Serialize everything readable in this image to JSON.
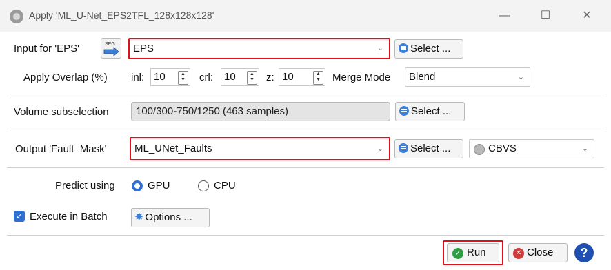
{
  "window": {
    "title": "Apply 'ML_U-Net_EPS2TFL_128x128x128'",
    "minimize": "—",
    "maximize": "☐",
    "close": "✕"
  },
  "input": {
    "label": "Input for 'EPS'",
    "value": "EPS",
    "select_label": "Select ..."
  },
  "overlap": {
    "label": "Apply Overlap (%)",
    "inl_label": "inl:",
    "inl_value": "10",
    "crl_label": "crl:",
    "crl_value": "10",
    "z_label": "z:",
    "z_value": "10",
    "merge_label": "Merge Mode",
    "merge_value": "Blend"
  },
  "volume": {
    "label": "Volume subselection",
    "value": "100/300-750/1250 (463 samples)",
    "select_label": "Select ..."
  },
  "output": {
    "label": "Output 'Fault_Mask'",
    "value": "ML_UNet_Faults",
    "select_label": "Select ...",
    "format_value": "CBVS"
  },
  "predict": {
    "label": "Predict using",
    "options": [
      "GPU",
      "CPU"
    ],
    "selected": "GPU"
  },
  "batch": {
    "label": "Execute in Batch",
    "checked": true,
    "options_label": "Options ..."
  },
  "footer": {
    "run_label": "Run",
    "close_label": "Close",
    "help_label": "?"
  },
  "colors": {
    "highlight": "#e0101a",
    "accent": "#2f6fd1",
    "run_green": "#2e9e44",
    "close_red": "#d23b3b"
  },
  "icons": [
    "app-icon",
    "seg-arrow-icon",
    "select-icon",
    "options-gear-icon",
    "run-check-icon",
    "close-x-icon",
    "help-icon",
    "cbvs-icon"
  ]
}
